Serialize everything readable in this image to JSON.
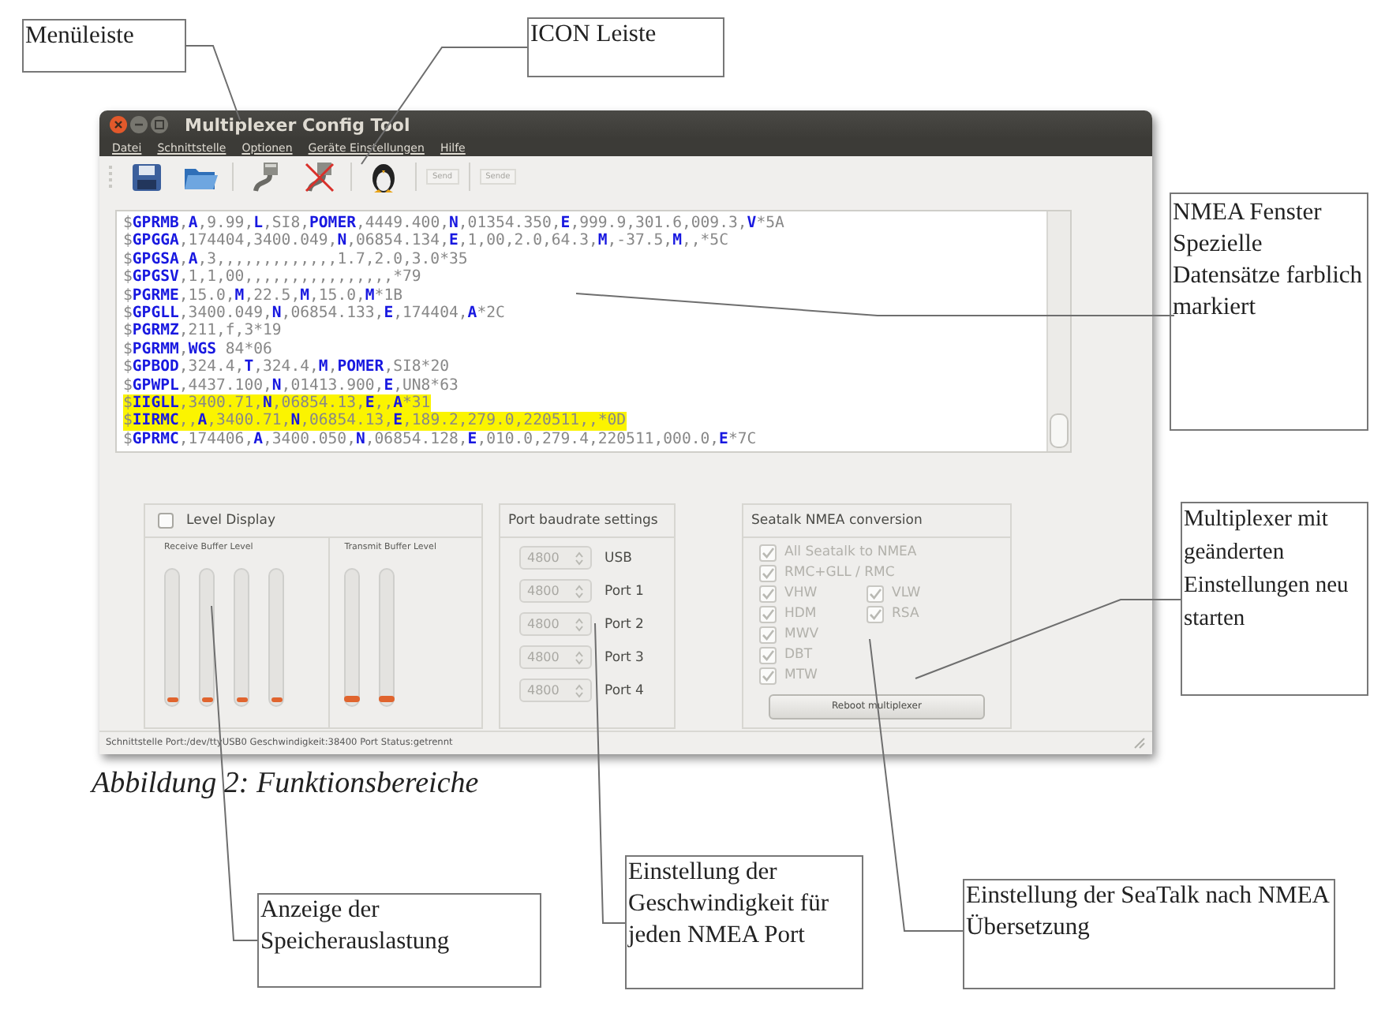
{
  "window": {
    "title": "Multiplexer Config Tool"
  },
  "menu": [
    "Datei",
    "Schnittstelle",
    "Optionen",
    "Geräte Einstellungen",
    "Hilfe"
  ],
  "toolbar": [
    {
      "kind": "save"
    },
    {
      "kind": "open"
    },
    {
      "kind": "connect"
    },
    {
      "kind": "disconnect"
    },
    {
      "kind": "penguin"
    },
    {
      "kind": "text",
      "label": "Send",
      "disabled": true
    },
    {
      "kind": "text",
      "label": "Sende",
      "disabled": true
    }
  ],
  "nmea_lines": [
    {
      "text": "$**GPRMB**,**A**,9.99,**L**,SI8,**POMER**,4449.400,**N**,01354.350,**E**,999.9,301.6,009.3,**V***5A",
      "highlighted": false
    },
    {
      "text": "$**GPGGA**,174404,3400.049,**N**,06854.134,**E**,1,00,2.0,64.3,**M**,-37.5,**M**,,*5C",
      "highlighted": false
    },
    {
      "text": "$**GPGSA**,**A**,3,,,,,,,,,,,,,1.7,2.0,3.0*35",
      "highlighted": false
    },
    {
      "text": "$**GPGSV**,1,1,00,,,,,,,,,,,,,,,,*79",
      "highlighted": false
    },
    {
      "text": "$**PGRME**,15.0,**M**,22.5,**M**,15.0,**M***1B",
      "highlighted": false
    },
    {
      "text": "$**GPGLL**,3400.049,**N**,06854.133,**E**,174404,**A***2C",
      "highlighted": false
    },
    {
      "text": "$**PGRMZ**,211,f,3*19",
      "highlighted": false
    },
    {
      "text": "$**PGRMM**,**WGS** 84*06",
      "highlighted": false
    },
    {
      "text": "$**GPBOD**,324.4,**T**,324.4,**M**,**POMER**,SI8*20",
      "highlighted": false
    },
    {
      "text": "$**GPWPL**,4437.100,**N**,01413.900,**E**,UN8*63",
      "highlighted": false
    },
    {
      "text": "$**IIGLL**,3400.71,**N**,06854.13,**E**,,**A***31",
      "highlighted": true
    },
    {
      "text": "$**IIRMC**,,**A**,3400.71,**N**,06854.13,**E**,189.2,279.0,220511,,*0D",
      "highlighted": true
    },
    {
      "text": "$**GPRMC**,174406,**A**,3400.050,**N**,06854.128,**E**,010.0,279.4,220511,000.0,**E***7C",
      "highlighted": false
    }
  ],
  "level_display": {
    "label": "Level Display",
    "checked": false,
    "groups": [
      {
        "title": "Receive Buffer Level",
        "bars": [
          {
            "level": 0.03
          },
          {
            "level": 0.03
          },
          {
            "level": 0.03
          },
          {
            "level": 0.03
          }
        ]
      },
      {
        "title": "Transmit Buffer Level",
        "bars": [
          {
            "level": 0.05
          },
          {
            "level": 0.05
          }
        ]
      }
    ]
  },
  "baudrate": {
    "title": "Port baudrate settings",
    "ports": [
      {
        "value": "4800",
        "label": "USB",
        "disabled": true
      },
      {
        "value": "4800",
        "label": "Port 1",
        "disabled": true
      },
      {
        "value": "4800",
        "label": "Port 2",
        "disabled": true
      },
      {
        "value": "4800",
        "label": "Port 3",
        "disabled": true
      },
      {
        "value": "4800",
        "label": "Port 4",
        "disabled": true
      }
    ]
  },
  "seatalk": {
    "title": "Seatalk NMEA conversion",
    "rows": [
      [
        {
          "label": "All Seatalk to NMEA",
          "checked": true,
          "disabled": true
        }
      ],
      [
        {
          "label": "RMC+GLL / RMC",
          "checked": true,
          "disabled": true
        }
      ],
      [
        {
          "label": "VHW",
          "checked": true,
          "disabled": true
        },
        {
          "label": "VLW",
          "checked": true,
          "disabled": true
        }
      ],
      [
        {
          "label": "HDM",
          "checked": true,
          "disabled": true
        },
        {
          "label": "RSA",
          "checked": true,
          "disabled": true
        }
      ],
      [
        {
          "label": "MWV",
          "checked": true,
          "disabled": true
        }
      ],
      [
        {
          "label": "DBT",
          "checked": true,
          "disabled": true
        }
      ],
      [
        {
          "label": "MTW",
          "checked": true,
          "disabled": true
        }
      ]
    ],
    "button": "Reboot multiplexer"
  },
  "status_bar": "Schnittstelle Port:/dev/ttyUSB0 Geschwindigkeit:38400 Port Status:getrennt",
  "caption": "Abbildung 2: Funktionsbereiche",
  "callouts": [
    "Menüleiste",
    "ICON Leiste",
    "NMEA Fenster Spezielle Datensätze farblich markiert",
    "Multiplexer mit geänderten Einstellungen neu starten",
    "Anzeige der Speicherauslastung",
    "Einstellung der Geschwindigkeit für jeden NMEA Port",
    "Einstellung der SeaTalk nach NMEA Übersetzung"
  ]
}
